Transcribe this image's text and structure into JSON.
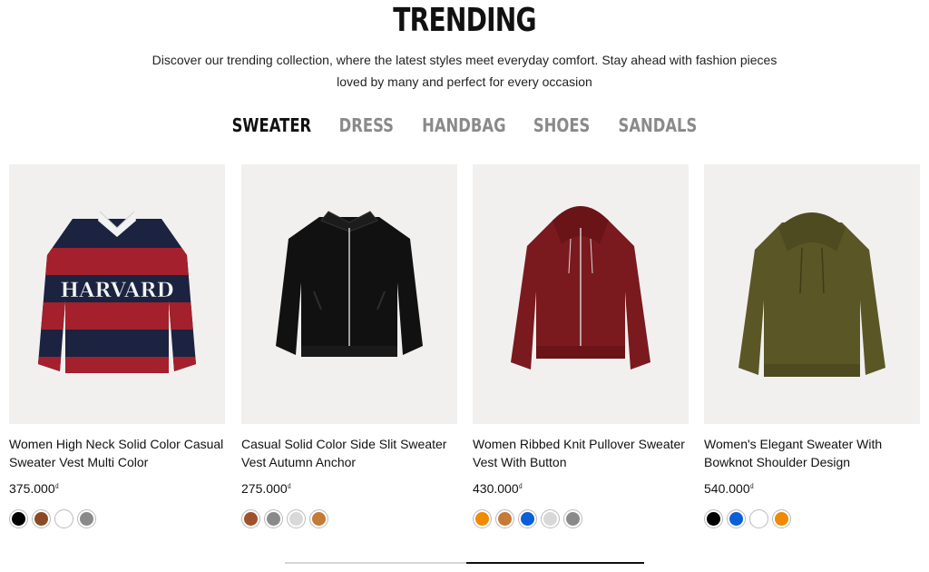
{
  "header": {
    "title": "TRENDING",
    "subtitle": "Discover our trending collection, where the latest styles meet everyday comfort. Stay ahead with fashion pieces loved by many and perfect for every occasion"
  },
  "tabs": [
    {
      "label": "SWEATER",
      "active": true
    },
    {
      "label": "DRESS",
      "active": false
    },
    {
      "label": "HANDBAG",
      "active": false
    },
    {
      "label": "SHOES",
      "active": false
    },
    {
      "label": "SANDALS",
      "active": false
    }
  ],
  "products": [
    {
      "name": "Women High Neck Solid Color Casual Sweater Vest Multi Color",
      "price": "375.000",
      "currency": "₫",
      "image_icon": "striped-rugby-sweater-icon",
      "swatches": [
        "#000000",
        "#8a4a24",
        "#ffffff",
        "#8a8a8a"
      ]
    },
    {
      "name": "Casual Solid Color Side Slit Sweater Vest Autumn Anchor",
      "price": "275.000",
      "currency": "₫",
      "image_icon": "black-bomber-jacket-icon",
      "swatches": [
        "#a0522d",
        "#8a8a8a",
        "#d8d8d8",
        "#c57a35"
      ]
    },
    {
      "name": "Women Ribbed Knit Pullover Sweater Vest With Button",
      "price": "430.000",
      "currency": "₫",
      "image_icon": "burgundy-zip-hoodie-icon",
      "swatches": [
        "#f08a00",
        "#c57a35",
        "#0a5fd8",
        "#d8d8d8",
        "#8a8a8a"
      ]
    },
    {
      "name": "Women's Elegant Sweater With Bowknot Shoulder Design",
      "price": "540.000",
      "currency": "₫",
      "image_icon": "olive-knit-hoodie-icon",
      "swatches": [
        "#000000",
        "#0a5fd8",
        "#ffffff",
        "#f08a00"
      ]
    }
  ],
  "carousel": {
    "progress": 0.5
  }
}
